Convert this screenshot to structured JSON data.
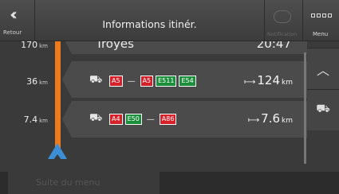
{
  "header": {
    "back_label": "Retour",
    "back_icon": "double-chevron-left-icon",
    "title": "Informations itinér.",
    "notification_label": "Notification",
    "menu_label": "Menu"
  },
  "rows": [
    {
      "distance": "170",
      "distance_unit": "km",
      "label": "Troyes",
      "time": "20:47"
    },
    {
      "distance": "36",
      "distance_unit": "km",
      "road_icon": "motorway-icon",
      "roads_before": [
        {
          "name": "A5",
          "color": "red"
        }
      ],
      "roads_after": [
        {
          "name": "A5",
          "color": "red"
        },
        {
          "name": "E511",
          "color": "green"
        },
        {
          "name": "E54",
          "color": "green"
        }
      ],
      "length": "124",
      "length_unit": "km"
    },
    {
      "distance": "7.4",
      "distance_unit": "km",
      "road_icon": "motorway-icon",
      "roads_before": [
        {
          "name": "A4",
          "color": "red"
        },
        {
          "name": "E50",
          "color": "green"
        }
      ],
      "roads_after": [
        {
          "name": "A86",
          "color": "red"
        }
      ],
      "length": "7.6",
      "length_unit": "km"
    }
  ],
  "side": {
    "up_icon": "chevron-up-icon",
    "filter_icon": "motorway-icon"
  },
  "bottom": {
    "button_label": "Suite du menu"
  },
  "colors": {
    "route": "#ee7a1c",
    "position_arrow": "#3c8fd6",
    "badge_red": "#d6202a",
    "badge_green": "#1c8f3c"
  }
}
